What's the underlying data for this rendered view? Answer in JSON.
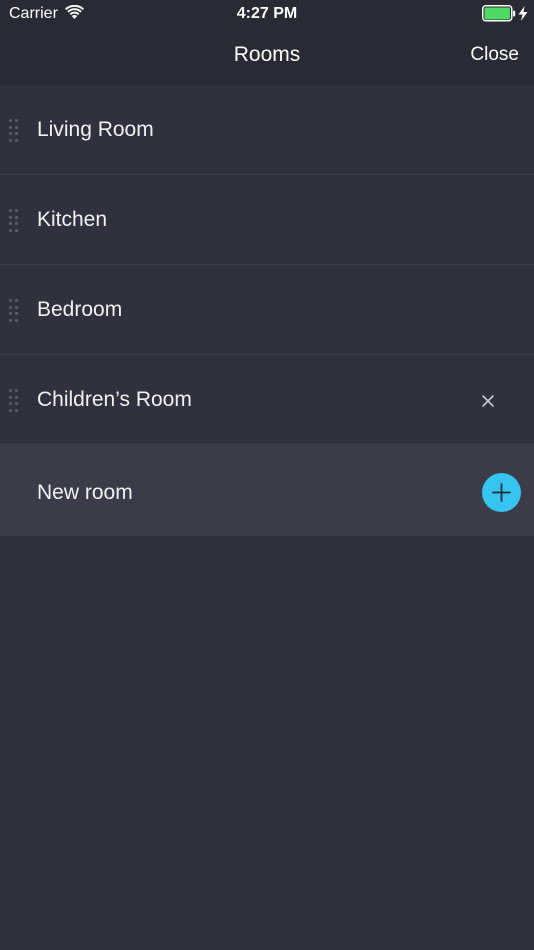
{
  "status_bar": {
    "carrier": "Carrier",
    "time": "4:27 PM",
    "battery_color": "#4cd964"
  },
  "nav": {
    "title": "Rooms",
    "close_label": "Close"
  },
  "rooms": [
    {
      "name": "Living Room",
      "deletable": false
    },
    {
      "name": "Kitchen",
      "deletable": false
    },
    {
      "name": "Bedroom",
      "deletable": false
    },
    {
      "name": "Children’s Room",
      "deletable": true
    }
  ],
  "new_room": {
    "label": "New room",
    "accent": "#35c5f0"
  }
}
